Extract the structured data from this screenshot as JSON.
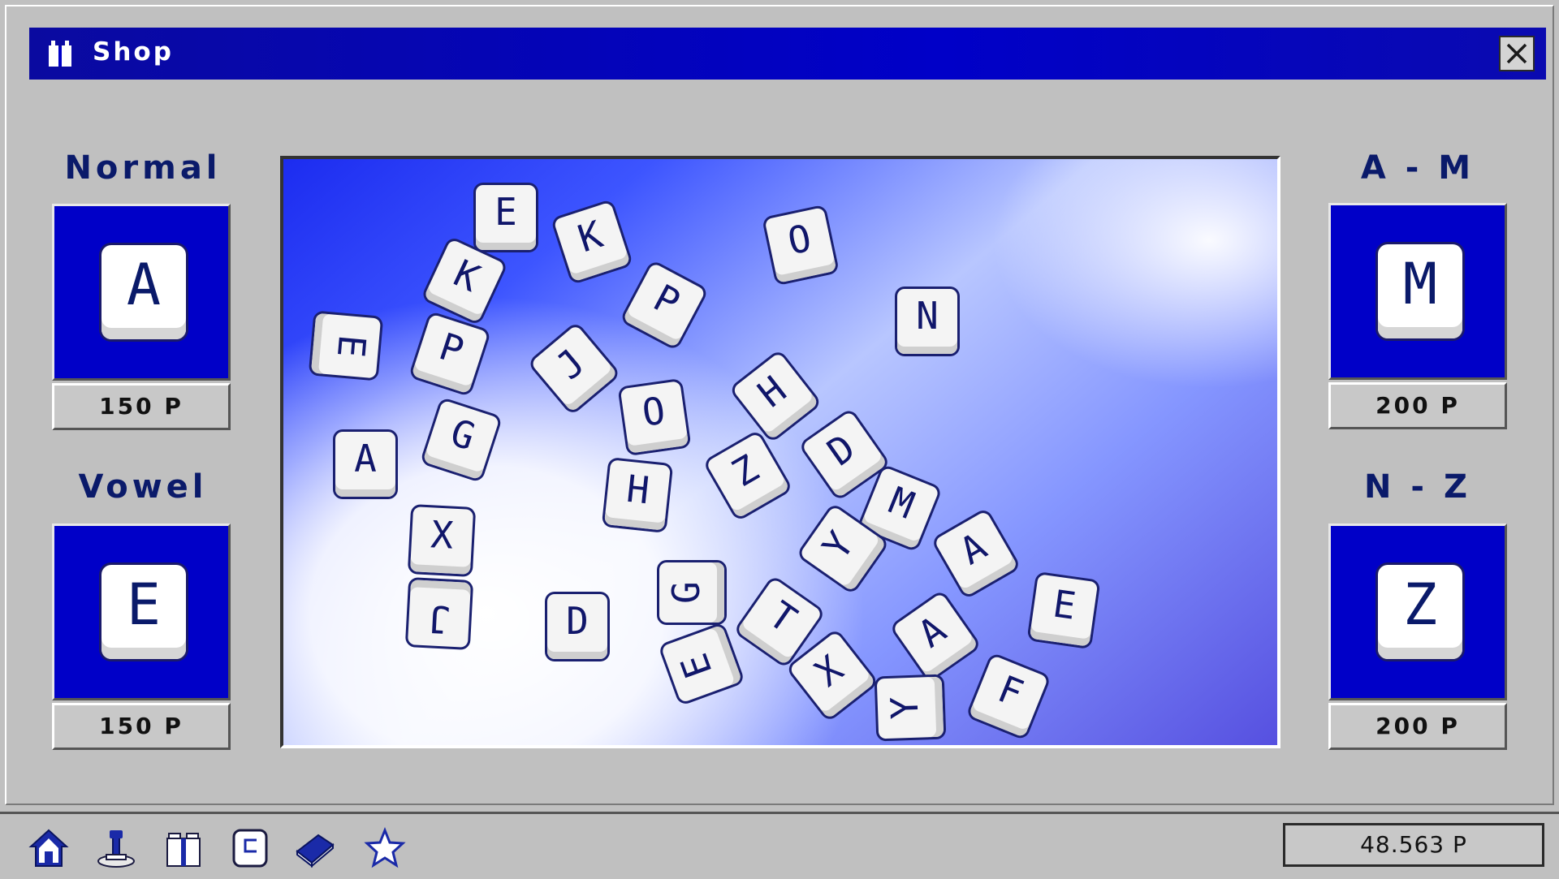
{
  "window": {
    "title": "Shop"
  },
  "shop": {
    "packs": [
      {
        "title": "Normal",
        "letter": "A",
        "price": "150 P"
      },
      {
        "title": "Vowel",
        "letter": "E",
        "price": "150 P"
      },
      {
        "title": "A - M",
        "letter": "M",
        "price": "200 P"
      },
      {
        "title": "N - Z",
        "letter": "Z",
        "price": "200 P"
      }
    ]
  },
  "preview": {
    "keys": [
      "E",
      "K",
      "K",
      "O",
      "P",
      "N",
      "E",
      "P",
      "J",
      "H",
      "O",
      "G",
      "A",
      "D",
      "Z",
      "H",
      "M",
      "X",
      "Y",
      "A",
      "J",
      "G",
      "T",
      "D",
      "E",
      "A",
      "E",
      "X",
      "Y",
      "F"
    ]
  },
  "taskbar": {
    "items": [
      "home-icon",
      "joystick-icon",
      "gift-icon",
      "c-key-icon",
      "book-icon",
      "star-icon"
    ],
    "points": "48.563 P"
  },
  "colors": {
    "titlebar": "#0000c8",
    "tile_bg": "#0000c8",
    "text_dark": "#0a1a6a",
    "window_bg": "#c0c0c0"
  }
}
